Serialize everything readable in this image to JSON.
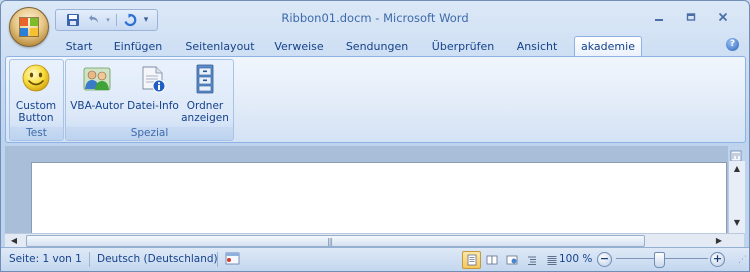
{
  "window": {
    "title": "Ribbon01.docm - Microsoft Word",
    "minimize_icon": "minimize-icon",
    "maximize_icon": "maximize-icon",
    "close_icon": "close-icon"
  },
  "quick_access": {
    "save_icon": "save-icon",
    "undo_icon": "undo-icon",
    "redo_icon": "redo-icon",
    "customize_icon": "customize-qat-icon"
  },
  "tabs": [
    {
      "label": "Start"
    },
    {
      "label": "Einfügen"
    },
    {
      "label": "Seitenlayout"
    },
    {
      "label": "Verweise"
    },
    {
      "label": "Sendungen"
    },
    {
      "label": "Überprüfen"
    },
    {
      "label": "Ansicht"
    },
    {
      "label": "akademie",
      "active": true
    }
  ],
  "ribbon": {
    "groups": [
      {
        "label": "Test",
        "buttons": [
          {
            "label_line1": "Custom",
            "label_line2": "Button",
            "icon": "smiley-icon"
          }
        ]
      },
      {
        "label": "Spezial",
        "buttons": [
          {
            "label_line1": "VBA-Autor",
            "label_line2": "",
            "icon": "users-icon"
          },
          {
            "label_line1": "Datei-Info",
            "label_line2": "",
            "icon": "document-info-icon"
          },
          {
            "label_line1": "Ordner",
            "label_line2": "anzeigen",
            "icon": "folder-cabinet-icon"
          }
        ]
      }
    ]
  },
  "statusbar": {
    "page": "Seite: 1 von 1",
    "language": "Deutsch (Deutschland)",
    "zoom": "100 %",
    "zoom_minus": "−",
    "zoom_plus": "+",
    "view_modes": [
      "print-layout",
      "full-screen-reading",
      "web-layout",
      "outline",
      "draft"
    ],
    "active_view": "print-layout"
  },
  "colors": {
    "ribbon_text": "#15428b",
    "active_view": "#f7c65a",
    "window_frame": "#6f8db5"
  }
}
